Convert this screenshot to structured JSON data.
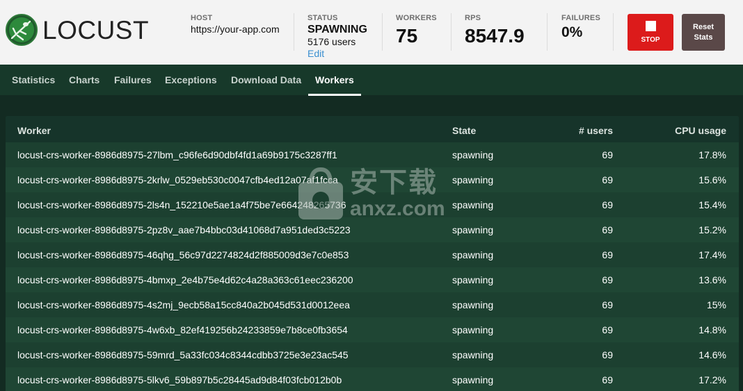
{
  "app": {
    "logo_text": "LOCUST"
  },
  "header": {
    "host": {
      "label": "HOST",
      "value": "https://your-app.com"
    },
    "status": {
      "label": "STATUS",
      "value": "SPAWNING",
      "users": "5176 users",
      "edit": "Edit"
    },
    "workers": {
      "label": "WORKERS",
      "value": "75"
    },
    "rps": {
      "label": "RPS",
      "value": "8547.9"
    },
    "failures": {
      "label": "FAILURES",
      "value": "0%"
    },
    "stop_label": "STOP",
    "reset_label": "Reset Stats"
  },
  "tabs": [
    {
      "label": "Statistics"
    },
    {
      "label": "Charts"
    },
    {
      "label": "Failures"
    },
    {
      "label": "Exceptions"
    },
    {
      "label": "Download Data"
    },
    {
      "label": "Workers",
      "active": true
    }
  ],
  "table": {
    "columns": [
      "Worker",
      "State",
      "# users",
      "CPU usage"
    ],
    "rows": [
      {
        "worker": "locust-crs-worker-8986d8975-27lbm_c96fe6d90dbf4fd1a69b9175c3287ff1",
        "state": "spawning",
        "users": "69",
        "cpu": "17.8%"
      },
      {
        "worker": "locust-crs-worker-8986d8975-2krlw_0529eb530c0047cfb4ed12a07af1fcca",
        "state": "spawning",
        "users": "69",
        "cpu": "15.6%"
      },
      {
        "worker": "locust-crs-worker-8986d8975-2ls4n_152210e5ae1a4f75be7e664248265736",
        "state": "spawning",
        "users": "69",
        "cpu": "15.4%"
      },
      {
        "worker": "locust-crs-worker-8986d8975-2pz8v_aae7b4bbc03d41068d7a951ded3c5223",
        "state": "spawning",
        "users": "69",
        "cpu": "15.2%"
      },
      {
        "worker": "locust-crs-worker-8986d8975-46qhg_56c97d2274824d2f885009d3e7c0e853",
        "state": "spawning",
        "users": "69",
        "cpu": "17.4%"
      },
      {
        "worker": "locust-crs-worker-8986d8975-4bmxp_2e4b75e4d62c4a28a363c61eec236200",
        "state": "spawning",
        "users": "69",
        "cpu": "13.6%"
      },
      {
        "worker": "locust-crs-worker-8986d8975-4s2mj_9ecb58a15cc840a2b045d531d0012eea",
        "state": "spawning",
        "users": "69",
        "cpu": "15%"
      },
      {
        "worker": "locust-crs-worker-8986d8975-4w6xb_82ef419256b24233859e7b8ce0fb3654",
        "state": "spawning",
        "users": "69",
        "cpu": "14.8%"
      },
      {
        "worker": "locust-crs-worker-8986d8975-59mrd_5a33fc034c8344cdbb3725e3e23ac545",
        "state": "spawning",
        "users": "69",
        "cpu": "14.6%"
      },
      {
        "worker": "locust-crs-worker-8986d8975-5lkv6_59b897b5c28445ad9d84f03fcb012b0b",
        "state": "spawning",
        "users": "69",
        "cpu": "17.2%"
      }
    ]
  },
  "watermark": {
    "cn": "安下载",
    "url": "anxz.com"
  },
  "colors": {
    "header_bg": "#f3f3f3",
    "nav_bg": "#17392a",
    "table_bg": "#1c4030",
    "stop": "#dc1b1b",
    "reset": "#5a4848",
    "link": "#3a8fd0"
  }
}
